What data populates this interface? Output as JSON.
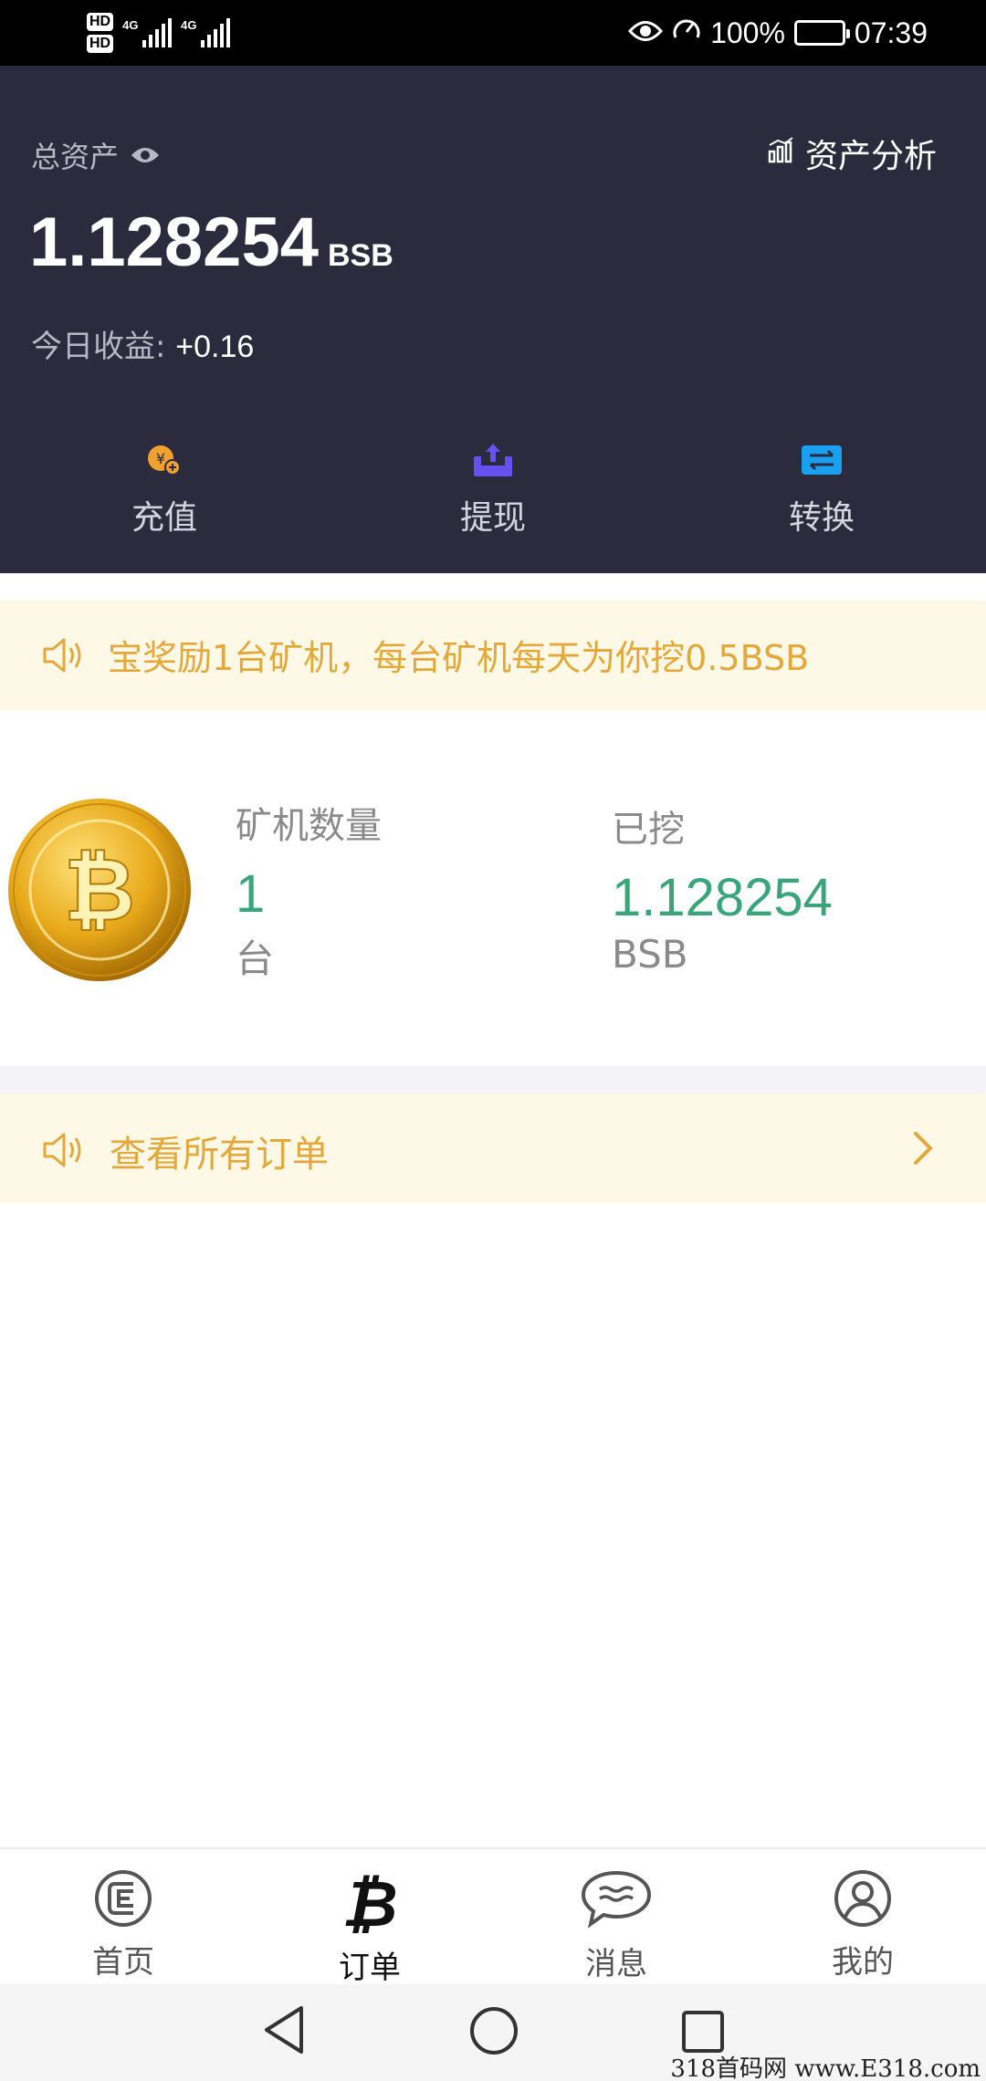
{
  "status_bar": {
    "hd1": "HD",
    "hd2": "HD",
    "sim1_network": "4G",
    "sim2_network": "4G",
    "battery_percent": "100%",
    "time": "07:39"
  },
  "header": {
    "total_assets_label": "总资产",
    "asset_analysis_label": "资产分析",
    "total_amount": "1.128254",
    "total_unit": "BSB",
    "today_earnings_label": "今日收益:",
    "today_earnings_value": "+0.16"
  },
  "actions": [
    {
      "label": "充值",
      "icon": "recharge-icon",
      "color": "#f0a030"
    },
    {
      "label": "提现",
      "icon": "withdraw-icon",
      "color": "#6a4ff0"
    },
    {
      "label": "转换",
      "icon": "exchange-icon",
      "color": "#1aa0f0"
    }
  ],
  "notice": {
    "text": "宝奖励1台矿机，每台矿机每天为你挖0.5BSB"
  },
  "mining": {
    "machine_count_label": "矿机数量",
    "machine_count_value": "1",
    "machine_count_unit": "台",
    "mined_label": "已挖",
    "mined_value": "1.128254",
    "mined_unit": "BSB"
  },
  "orders_bar": {
    "text": "查看所有订单"
  },
  "tabs": [
    {
      "label": "首页",
      "icon": "home-icon"
    },
    {
      "label": "订单",
      "icon": "bitcoin-icon",
      "active": true
    },
    {
      "label": "消息",
      "icon": "message-icon"
    },
    {
      "label": "我的",
      "icon": "profile-icon"
    }
  ],
  "watermark": "318首码网 www.E318.com",
  "colors": {
    "header_bg": "#2b2b3d",
    "accent_green": "#3aa57b",
    "notice_text": "#e3a83a",
    "notice_bg": "#fef8e7"
  }
}
